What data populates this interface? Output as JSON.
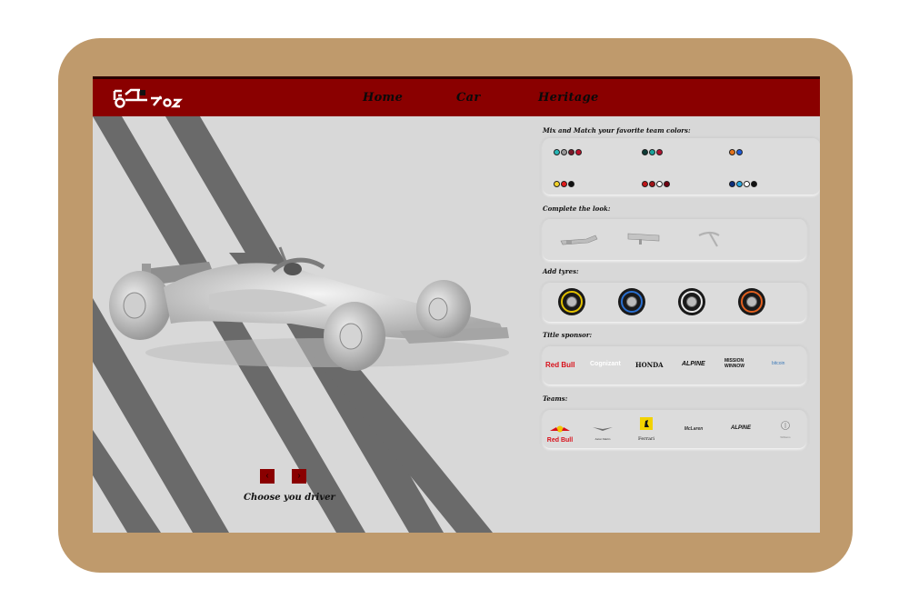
{
  "nav": {
    "logo_text": "F1 2022",
    "items": [
      "Home",
      "Car",
      "Heritage"
    ]
  },
  "hero": {
    "prev_icon": "‹",
    "next_icon": "›",
    "choose_label": "Choose you driver"
  },
  "colors": {
    "title": "Mix and Match your favorite team colors:",
    "swatches": [
      [
        "#27b7b7",
        "#9a9a9a",
        "#7a1a2a",
        "#c0102a"
      ],
      [
        "#0c3b35",
        "#19a39c",
        "#b01230"
      ],
      [
        "#e5731a",
        "#1e5bd8"
      ],
      [
        "#f2d12a",
        "#e01a1a",
        "#101010"
      ],
      [
        "#c01518",
        "#a01418",
        "#ffffff",
        "#700010"
      ],
      [
        "#0b2d7a",
        "#26a7e0",
        "#ffffff",
        "#101010"
      ]
    ]
  },
  "look": {
    "title": "Complete the look:",
    "parts": [
      "front-wing",
      "rear-wing",
      "halo"
    ]
  },
  "tyres": {
    "title": "Add tyres:",
    "compounds": [
      {
        "name": "medium",
        "color": "#e2c000"
      },
      {
        "name": "wet",
        "color": "#2a6fd0"
      },
      {
        "name": "hard",
        "color": "#e8e8e8"
      },
      {
        "name": "soft",
        "color": "#e06020"
      }
    ]
  },
  "sponsor": {
    "title": "Title sponsor:",
    "items": [
      "Red Bull",
      "Cognizant",
      "HONDA",
      "ALPINE",
      "MISSION WINNOW",
      "bitcoin"
    ]
  },
  "teams": {
    "title": "Teams:",
    "items": [
      "Red Bull",
      "Aston Martin",
      "Ferrari",
      "McLaren",
      "ALPINE",
      "Williams"
    ]
  }
}
